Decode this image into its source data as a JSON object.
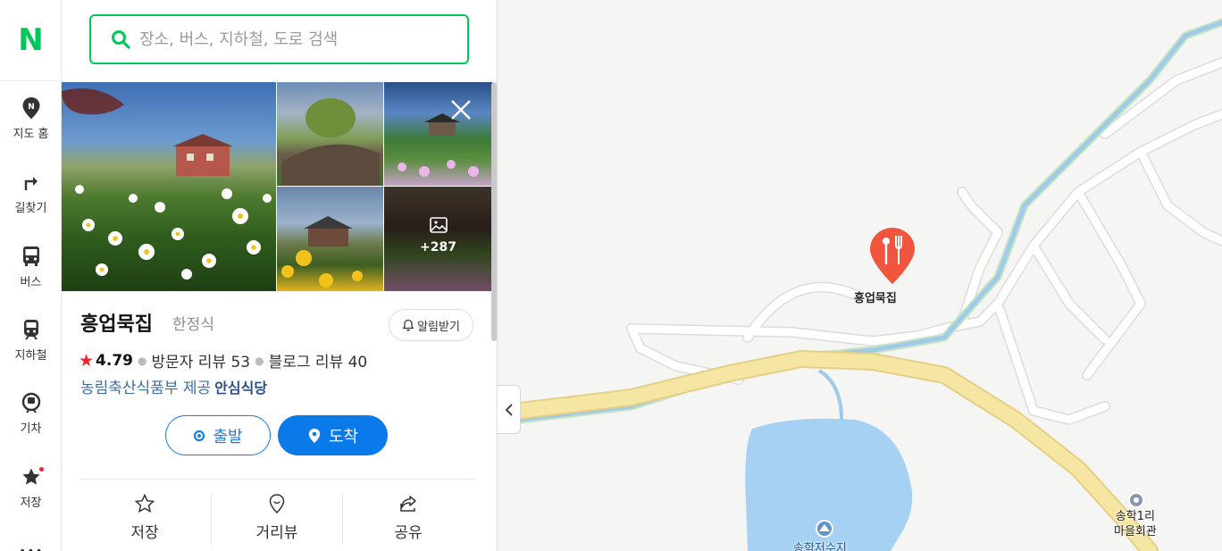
{
  "nav": {
    "logo": "N",
    "items": [
      {
        "label": "지도 홈",
        "icon": "map-pin-icon"
      },
      {
        "label": "길찾기",
        "icon": "directions-icon"
      },
      {
        "label": "버스",
        "icon": "bus-icon"
      },
      {
        "label": "지하철",
        "icon": "subway-icon"
      },
      {
        "label": "기차",
        "icon": "train-icon"
      },
      {
        "label": "저장",
        "icon": "star-icon"
      }
    ]
  },
  "search": {
    "placeholder": "장소, 버스, 지하철, 도로 검색"
  },
  "place": {
    "photo_more_count": "+287",
    "name": "흥업묵집",
    "category": "한정식",
    "alert_label": "알림받기",
    "rating": "4.79",
    "visitor_reviews": "방문자 리뷰 53",
    "blog_reviews": "블로그 리뷰 40",
    "provider": "농림축산식품부 제공",
    "provider_badge": "안심식당",
    "start_label": "출발",
    "arrive_label": "도착",
    "actions": [
      {
        "label": "저장",
        "icon": "star-outline-icon"
      },
      {
        "label": "거리뷰",
        "icon": "street-view-icon"
      },
      {
        "label": "공유",
        "icon": "share-icon"
      }
    ]
  },
  "map": {
    "pin_label": "흥업묵집",
    "labels": {
      "reservoir": "송학저수지",
      "hall_line1": "송학1리",
      "hall_line2": "마을회관"
    },
    "colors": {
      "pin": "#f2553d",
      "road": "#f5e6a3",
      "water": "#a6d1f2",
      "stream": "#9fcbeb"
    }
  },
  "colors": {
    "brand": "#03c75a",
    "accent": "#0a7aeb"
  }
}
